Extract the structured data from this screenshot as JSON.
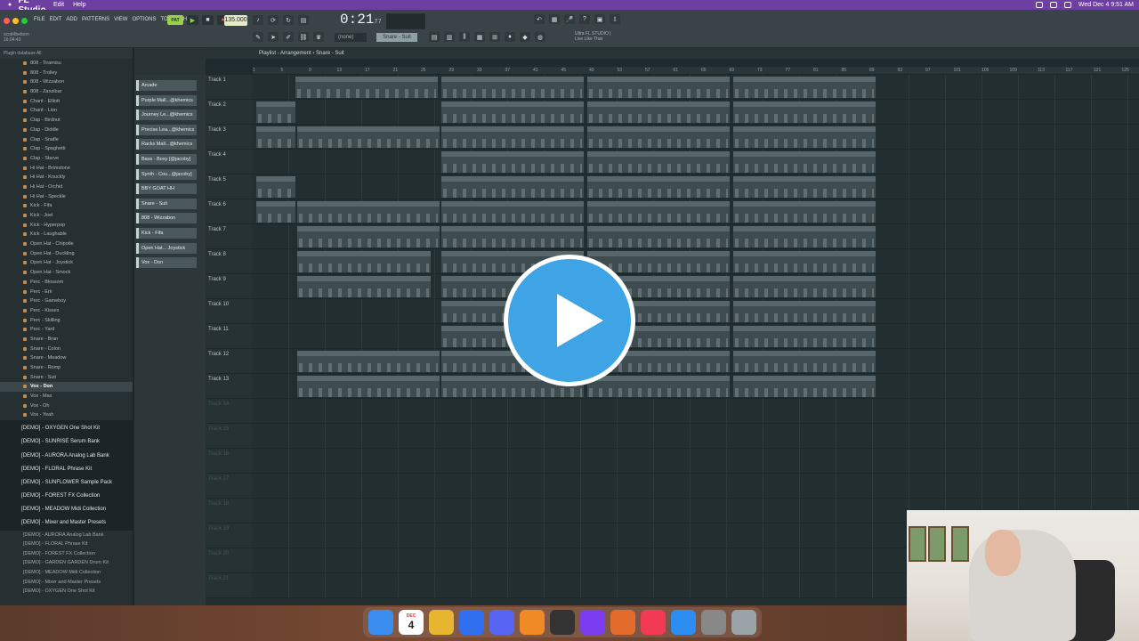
{
  "macbar": {
    "app": "FL Studio",
    "menus": [
      "Edit",
      "Help"
    ],
    "datetime": "Wed Dec 4  9:51 AM"
  },
  "flmenu": [
    "FILE",
    "EDIT",
    "ADD",
    "PATTERNS",
    "VIEW",
    "OPTIONS",
    "TOOLS",
    "HELP"
  ],
  "transport": {
    "pat_label": "PAT",
    "bpm": "135.000",
    "time_main": "0:21",
    "time_sub": "77",
    "snap": "(none)",
    "current_sample": "Snare - Suit",
    "hint_line1": "Ultra FL STUDIO |",
    "hint_line2": "Live Like That"
  },
  "window_file": {
    "name": "scott4bettern",
    "time": "16:04:43"
  },
  "browser": {
    "header": "Plugin database   All",
    "items": [
      "808 - Tiramisu",
      "808 - Trolley",
      "808 - Wizzabon",
      "808 - Zanzibar",
      "Chant - Elliott",
      "Chant - Lion",
      "Clap - Birdnut",
      "Clap - Diddle",
      "Clap - Snafle",
      "Clap - Spaghetti",
      "Clap - Starve",
      "Hi Hat - Brimstone",
      "Hi Hat - Knuckly",
      "Hi Hat - Orchid",
      "Hi Hat - Speckle",
      "Kick - Fifa",
      "Kick - Joel",
      "Kick - Hyperpop",
      "Kick - Laughable",
      "Open Hat - Chipotle",
      "Open Hat - Duckling",
      "Open Hat - Joystick",
      "Open Hat - Smock",
      "Perc - Blossom",
      "Perc - Erk",
      "Perc - Gameboy",
      "Perc - Kisses",
      "Perc - Skilling",
      "Perc - Yard",
      "Snare - Bran",
      "Snare - Colon",
      "Snare - Meadow",
      "Snare - Romp",
      "Snare - Suit",
      "Vox - Don",
      "Vox - Max",
      "Vox - Oh",
      "Vox - Yeah"
    ],
    "active_index": 34,
    "packs": [
      "[DEMO] - OXYGEN One Shot Kit",
      "[DEMO] - SUNRISE Serum Bank",
      "[DEMO] - AURORA Analog Lab Bank",
      "[DEMO] - FLORAL Phrase Kit",
      "[DEMO] - SUNFLOWER Sample Pack",
      "[DEMO] - FOREST FX Collection",
      "[DEMO] - MEADOW Midi Collection",
      "[DEMO] - Mixer and Master Presets"
    ],
    "folders": [
      "[DEMO] - AURORA Analog Lab Bank",
      "[DEMO] - FLORAL Phrase Kit",
      "[DEMO] - FOREST FX Collection",
      "[DEMO] - GARDEN GARDEN Drum Kit",
      "[DEMO] - MEADOW Midi Collection",
      "[DEMO] - Mixer and Master Presets",
      "[DEMO] - OXYGEN One Shot Kit"
    ]
  },
  "playlist": {
    "title": "Playlist - Arrangement  ›  Snare - Suit",
    "ruler": [
      "1",
      "5",
      "9",
      "13",
      "17",
      "21",
      "25",
      "29",
      "33",
      "37",
      "41",
      "45",
      "49",
      "53",
      "57",
      "61",
      "65",
      "69",
      "73",
      "77",
      "81",
      "85",
      "89",
      "93",
      "97",
      "101",
      "105",
      "109",
      "113",
      "117",
      "121",
      "125"
    ],
    "picker": [
      "Arcade",
      "Purple Mall...@khemics",
      "Journey Le...@khemics",
      "Precise Lea...@khemics",
      "Racks Mall...@khemics",
      "Bass - Boxy [@jacoby]",
      "Synth - Cou...@jacoby]",
      "BBY GOAT HH",
      "Snare - Suit",
      "808 - Wizzabon",
      "Kick - Fifa",
      "Open Hat... Joystick",
      "Vox - Don"
    ],
    "tracks": [
      {
        "name": "Track 1",
        "clips": [
          [
            "Arcade",
            48,
            160
          ],
          [
            "Arcade",
            212,
            160
          ],
          [
            "Arcade",
            376,
            160
          ],
          [
            "Arcade",
            540,
            160
          ]
        ]
      },
      {
        "name": "Track 2",
        "clips": [
          [
            "Purple M...emics",
            4,
            44
          ],
          [
            "Purple Mallet - C - @khemics",
            212,
            160
          ],
          [
            "Purple Mallet - C - @khemics",
            376,
            160
          ],
          [
            "Purple Mallet - C - @khemics",
            540,
            160
          ]
        ]
      },
      {
        "name": "Track 3",
        "clips": [
          [
            "Journey...emics",
            4,
            44
          ],
          [
            "Journey Lead - C - @khemics",
            50,
            160
          ],
          [
            "Journey Lead - C - @khemics",
            212,
            160
          ],
          [
            "Journey Lead - C - @khemics",
            376,
            160
          ],
          [
            "Journey Lead - C - @khemics",
            540,
            160
          ]
        ]
      },
      {
        "name": "Track 4",
        "clips": [
          [
            "Precise Lead - C - @khemics",
            212,
            160
          ],
          [
            "Precise Lead - C - @khemics",
            376,
            160
          ],
          [
            "Precise Lead - C - @khemics",
            540,
            160
          ]
        ]
      },
      {
        "name": "Track 5",
        "clips": [
          [
            "Racks M...emics",
            4,
            44
          ],
          [
            "Racks Mallet - C - @khemics",
            212,
            160
          ],
          [
            "Racks Mallet - C - @khemics",
            376,
            160
          ],
          [
            "Racks Mallet - C - @khemics",
            540,
            160
          ]
        ]
      },
      {
        "name": "Track 6",
        "clips": [
          [
            "Bass - ...acoby]",
            4,
            44
          ],
          [
            "Bass - Boxy [@jacoby]]",
            50,
            160
          ],
          [
            "Bass - Boxy [@jacoby]]",
            212,
            160
          ],
          [
            "Bass - Boxy [@jacoby]]",
            376,
            160
          ],
          [
            "Bass - Boxy [@jacoby]]",
            540,
            160
          ]
        ]
      },
      {
        "name": "Track 7",
        "clips": [
          [
            "Synth - Countdown [@jacoby]]",
            50,
            160
          ],
          [
            "Synth - Countdown [@jacoby]]",
            212,
            160
          ],
          [
            "Synth - Countdown [@jacoby]]",
            376,
            160
          ],
          [
            "Synth - Countdown [@jacoby]]",
            540,
            160
          ]
        ]
      },
      {
        "name": "Track 8",
        "clips": [
          [
            "BBY GOAT HH",
            50,
            150
          ],
          [
            "BBY GOAT HH",
            212,
            160
          ],
          [
            "BBY GOAT HH",
            376,
            160
          ],
          [
            "BBY GOAT HH",
            540,
            160
          ]
        ]
      },
      {
        "name": "Track 9",
        "clips": [
          [
            "Snare - Suit",
            50,
            150
          ],
          [
            "Snare - Suit",
            212,
            160
          ],
          [
            "Snare - Suit",
            376,
            160
          ],
          [
            "Snare - Suit",
            540,
            160
          ]
        ]
      },
      {
        "name": "Track 10",
        "clips": [
          [
            "808 - Wizzabon",
            212,
            160
          ],
          [
            "808 - Wizzabon",
            376,
            160
          ],
          [
            "808 - Wizzabon",
            540,
            160
          ]
        ]
      },
      {
        "name": "Track 11",
        "clips": [
          [
            "Kick - Fifa",
            212,
            160
          ],
          [
            "Kick - Fifa",
            376,
            160
          ],
          [
            "Kick - Fifa",
            540,
            160
          ]
        ]
      },
      {
        "name": "Track 12",
        "clips": [
          [
            "Open Hat - Joystick",
            50,
            160
          ],
          [
            "Open Hat - Joystick",
            212,
            160
          ],
          [
            "Open Hat - Joystick",
            376,
            160
          ],
          [
            "Open Hat - Joystick",
            540,
            160
          ]
        ]
      },
      {
        "name": "Track 13",
        "clips": [
          [
            "Vox - Don",
            50,
            160
          ],
          [
            "Vox - Don",
            212,
            160
          ],
          [
            "Vox - Don",
            376,
            160
          ],
          [
            "Vox - Don",
            540,
            160
          ]
        ]
      },
      {
        "name": "Track 14",
        "clips": []
      },
      {
        "name": "Track 15",
        "clips": []
      },
      {
        "name": "Track 16",
        "clips": []
      },
      {
        "name": "Track 17",
        "clips": []
      },
      {
        "name": "Track 18",
        "clips": []
      },
      {
        "name": "Track 19",
        "clips": []
      },
      {
        "name": "Track 20",
        "clips": []
      },
      {
        "name": "Track 21",
        "clips": []
      }
    ]
  },
  "dock": {
    "calendar_month": "DEC",
    "calendar_day": "4",
    "apps": [
      "finder-icon",
      "calendar-icon",
      "chrome-icon",
      "messenger-icon",
      "discord-icon",
      "fl-studio-icon",
      "obs-icon",
      "twitch-icon",
      "garageband-icon",
      "music-icon",
      "app-store-icon",
      "system-settings-icon",
      "trash-icon"
    ]
  },
  "colors": {
    "accent": "#9bcf4a",
    "menubar": "#6c3fa0",
    "play_button": "#3ea4e6"
  }
}
